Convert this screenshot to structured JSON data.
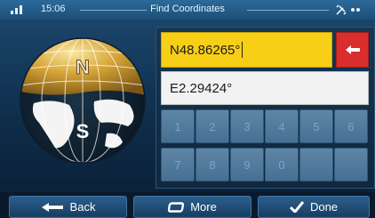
{
  "status": {
    "time": "15:06",
    "title": "Find Coordinates"
  },
  "globe": {
    "north_label": "N",
    "south_label": "S"
  },
  "fields": {
    "latitude": "N48.86265°",
    "longitude": "E2.29424°"
  },
  "keypad": {
    "row1": [
      "1",
      "2",
      "3",
      "4",
      "5",
      "6"
    ],
    "row2": [
      "7",
      "8",
      "9",
      "0",
      "",
      ""
    ]
  },
  "buttons": {
    "back": "Back",
    "more": "More",
    "done": "Done"
  },
  "colors": {
    "active_field": "#f7cf17",
    "backspace": "#d92e2b",
    "key": "#5f86a7"
  },
  "icons": {
    "signal": "signal-bars-icon",
    "satellite": "satellite-icon",
    "backspace": "backspace-arrow-icon",
    "back": "arrow-left-icon",
    "more": "more-rectangle-icon",
    "done": "checkmark-icon"
  }
}
